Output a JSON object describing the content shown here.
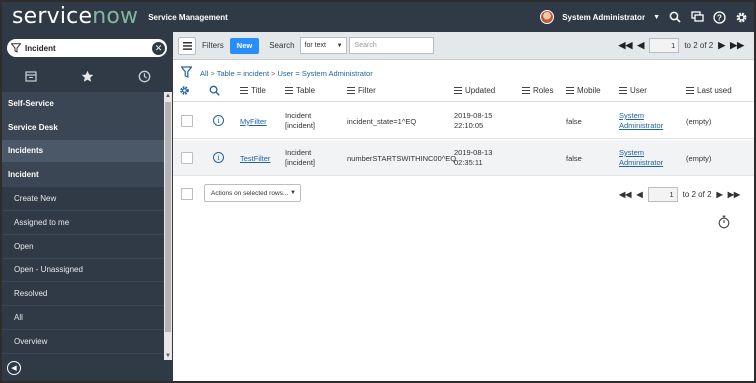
{
  "banner": {
    "logo_text_a": "service",
    "logo_text_b": "now",
    "app_title": "Service Management",
    "user_name": "System Administrator"
  },
  "sidebar": {
    "filter_value": "Incident",
    "items": [
      {
        "label": "Self-Service",
        "kind": "section"
      },
      {
        "label": "Service Desk",
        "kind": "section"
      },
      {
        "label": "Incidents",
        "kind": "active"
      },
      {
        "label": "Incident",
        "kind": "app"
      },
      {
        "label": "Create New",
        "kind": "module"
      },
      {
        "label": "Assigned to me",
        "kind": "module"
      },
      {
        "label": "Open",
        "kind": "module"
      },
      {
        "label": "Open - Unassigned",
        "kind": "module"
      },
      {
        "label": "Resolved",
        "kind": "module"
      },
      {
        "label": "All",
        "kind": "module"
      },
      {
        "label": "Overview",
        "kind": "module"
      }
    ]
  },
  "list_header": {
    "filters_label": "Filters",
    "new_label": "New",
    "search_label": "Search",
    "search_field": "for text",
    "search_placeholder": "Search",
    "page_value": "1",
    "page_of": "to 2 of 2"
  },
  "breadcrumb": {
    "all": "All",
    "parts": [
      "Table = incident",
      "User = System Administrator"
    ],
    "sep": ">"
  },
  "columns": [
    "Title",
    "Table",
    "Filter",
    "Updated",
    "Roles",
    "Mobile",
    "User",
    "Last used"
  ],
  "rows": [
    {
      "title": "MyFilter",
      "table_a": "Incident",
      "table_b": "[incident]",
      "filter": "incident_state=1^EQ",
      "updated_a": "2019-08-15",
      "updated_b": "22:10:05",
      "roles": "",
      "mobile": "false",
      "user_a": "System",
      "user_b": "Administrator",
      "last_used": "(empty)"
    },
    {
      "title": "TestFilter",
      "table_a": "Incident",
      "table_b": "[incident]",
      "filter": "numberSTARTSWITHINC00^EQ",
      "updated_a": "2019-08-13",
      "updated_b": "02:35:11",
      "roles": "",
      "mobile": "false",
      "user_a": "System",
      "user_b": "Administrator",
      "last_used": "(empty)"
    }
  ],
  "footer": {
    "actions_label": "Actions on selected rows...",
    "page_value": "1",
    "page_of": "to 2 of 2"
  }
}
